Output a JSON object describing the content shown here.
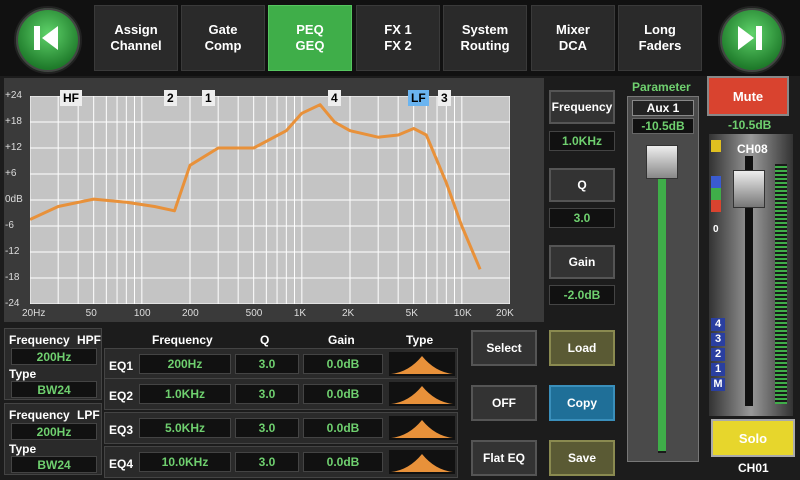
{
  "nav": {
    "tabs": [
      {
        "line1": "Assign",
        "line2": "Channel"
      },
      {
        "line1": "Gate",
        "line2": "Comp"
      },
      {
        "line1": "PEQ",
        "line2": "GEQ"
      },
      {
        "line1": "FX 1",
        "line2": "FX 2"
      },
      {
        "line1": "System",
        "line2": "Routing"
      },
      {
        "line1": "Mixer",
        "line2": "DCA"
      },
      {
        "line1": "Long",
        "line2": "Faders"
      }
    ],
    "active_index": 2,
    "prev_icon": "skip-back-icon",
    "next_icon": "skip-forward-icon"
  },
  "graph": {
    "y_ticks": [
      "+24",
      "+18",
      "+12",
      "+6",
      "0dB",
      "-6",
      "-12",
      "-18",
      "-24"
    ],
    "x_ticks": [
      "20Hz",
      "50",
      "100",
      "200",
      "500",
      "1K",
      "2K",
      "5K",
      "10K",
      "20K"
    ],
    "markers": [
      "HF",
      "2",
      "1",
      "4",
      "LF",
      "3"
    ],
    "curve_color": "#e8913a"
  },
  "chart_data": {
    "type": "line",
    "xscale": "log",
    "xlim": [
      20,
      20000
    ],
    "ylim": [
      -24,
      24
    ],
    "x": [
      20,
      30,
      50,
      80,
      120,
      160,
      200,
      300,
      500,
      800,
      1000,
      1300,
      1600,
      2000,
      3000,
      4000,
      5000,
      6000,
      8000,
      10000,
      13000
    ],
    "y": [
      -4.5,
      -1.5,
      0.2,
      -0.5,
      -1.5,
      -2.5,
      8,
      12,
      12,
      16,
      20,
      22,
      18,
      16,
      14.5,
      15,
      16.5,
      15,
      4,
      -6,
      -16
    ],
    "grid": true
  },
  "params": {
    "frequency_label": "Frequency",
    "frequency_value": "1.0KHz",
    "q_label": "Q",
    "q_value": "3.0",
    "gain_label": "Gain",
    "gain_value": "-2.0dB"
  },
  "hpf": {
    "freq_label": "Frequency",
    "filter_label": "HPF",
    "freq": "200Hz",
    "type_label": "Type",
    "type": "BW24"
  },
  "lpf": {
    "freq_label": "Frequency",
    "filter_label": "LPF",
    "freq": "200Hz",
    "type_label": "Type",
    "type": "BW24"
  },
  "eq_table": {
    "headers": [
      "Frequency",
      "Q",
      "Gain",
      "Type"
    ],
    "rows": [
      {
        "name": "EQ1",
        "freq": "200Hz",
        "q": "3.0",
        "gain": "0.0dB"
      },
      {
        "name": "EQ2",
        "freq": "1.0KHz",
        "q": "3.0",
        "gain": "0.0dB"
      },
      {
        "name": "EQ3",
        "freq": "5.0KHz",
        "q": "3.0",
        "gain": "0.0dB"
      },
      {
        "name": "EQ4",
        "freq": "10.0KHz",
        "q": "3.0",
        "gain": "0.0dB"
      }
    ]
  },
  "buttons": {
    "select": "Select",
    "off": "OFF",
    "flat_eq": "Flat EQ",
    "load": "Load",
    "copy": "Copy",
    "save": "Save"
  },
  "parameter": {
    "title": "Parameter",
    "bus": "Aux 1",
    "level": "-10.5dB"
  },
  "channel": {
    "mute": "Mute",
    "level": "-10.5dB",
    "name": "CH08",
    "zero_mark": "0",
    "dca": [
      "4",
      "3",
      "2",
      "1",
      "M"
    ],
    "solo": "Solo",
    "footer": "CH01",
    "colors": {
      "mute": "#d9432f",
      "solo": "#e7d62c"
    }
  }
}
